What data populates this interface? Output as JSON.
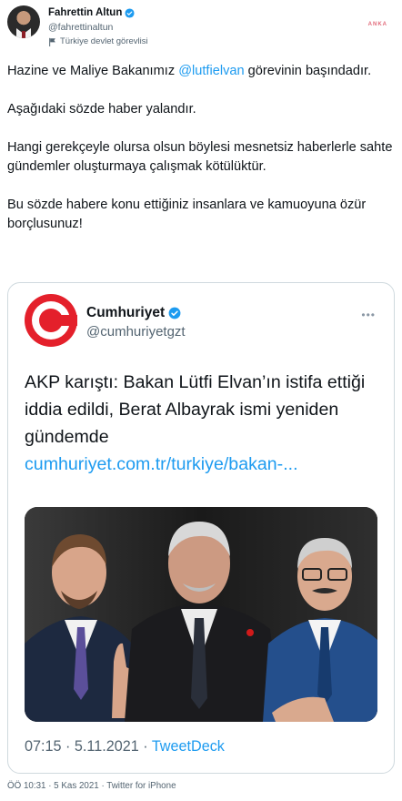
{
  "watermark": "ANKA",
  "author": {
    "name": "Fahrettin Altun",
    "handle": "@fahrettinaltun",
    "label": "Türkiye devlet görevlisi",
    "icons": {
      "verified": "verified-badge-icon",
      "label": "flag-icon"
    }
  },
  "tweet": {
    "p1_before": "Hazine ve Maliye Bakanımız ",
    "p1_mention": "@lutfielvan",
    "p1_after": " görevinin başındadır.",
    "p2": "Aşağıdaki sözde haber yalandır.",
    "p3": "Hangi gerekçeyle olursa olsun böylesi mesnetsiz haberlerle sahte gündemler oluşturmaya çalışmak kötülüktür.",
    "p4": "Bu sözde habere konu ettiğiniz insanlara ve kamuoyuna özür borçlusunuz!"
  },
  "quote": {
    "name": "Cumhuriyet",
    "handle": "@cumhuriyetgzt",
    "more": "•••",
    "text": "AKP karıştı: Bakan Lütfi Elvan’ın istifa ettiği iddia edildi, Berat Albayrak ismi yeniden gündemde",
    "link": "cumhuriyet.com.tr/turkiye/bakan-...",
    "time": "07:15 · 5.11.2021 · ",
    "source": "TweetDeck",
    "colors": {
      "brand": "#e4202b",
      "link": "#1d9bf0"
    }
  },
  "meta": "ÖÖ 10:31 · 5 Kas 2021 · Twitter for iPhone"
}
